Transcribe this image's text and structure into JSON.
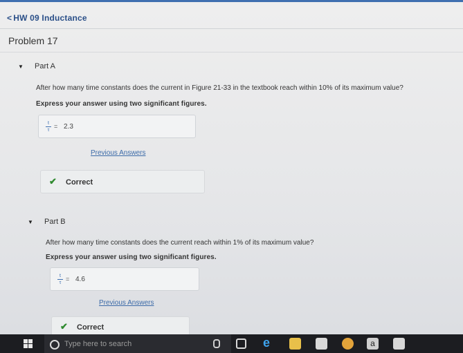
{
  "header": {
    "back_link": "HW 09 Inductance",
    "chevron": "<"
  },
  "problem_title": "Problem 17",
  "parts": [
    {
      "label": "Part A",
      "question": "After how many time constants does the current in Figure 21-33 in the textbook reach within 10% of its maximum value?",
      "instruction": "Express your answer using two significant figures.",
      "fraction_num": "t",
      "fraction_den": "τ",
      "equals": "=",
      "answer": "2.3",
      "previous_answers": "Previous Answers",
      "status": "Correct"
    },
    {
      "label": "Part B",
      "question": "After how many time constants does the current reach within 1% of its maximum value?",
      "instruction": "Express your answer using two significant figures.",
      "fraction_num": "t",
      "fraction_den": "τ",
      "equals": "=",
      "answer": "4.6",
      "previous_answers": "Previous Answers",
      "status": "Correct"
    }
  ],
  "taskbar": {
    "search_placeholder": "Type here to search",
    "icons": [
      "windows-start-icon",
      "search-icon",
      "microphone-icon",
      "task-view-icon",
      "edge-icon",
      "file-explorer-icon",
      "store-icon",
      "chrome-icon",
      "amazon-icon",
      "app-icon"
    ],
    "amazon_glyph": "a",
    "edge_glyph": "e"
  },
  "colors": {
    "link": "#2a4f88",
    "check": "#2f8a2f",
    "taskbar": "#1c1d21"
  }
}
